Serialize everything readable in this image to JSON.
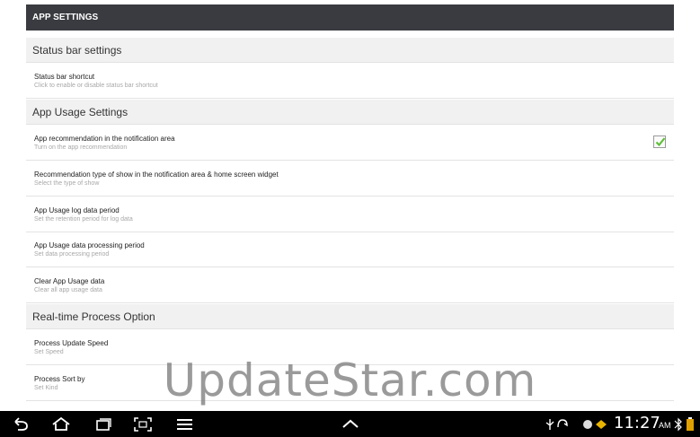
{
  "header": {
    "title": "APP SETTINGS"
  },
  "sections": [
    {
      "title": "Status bar settings"
    },
    {
      "title": "App Usage Settings"
    },
    {
      "title": "Real-time Process Option"
    }
  ],
  "items": [
    {
      "title": "Status bar shortcut",
      "subtitle": "Click to enable or disable status bar shortcut"
    },
    {
      "title": "App recommendation in the notification area",
      "subtitle": "Turn on the app recommendation",
      "checked": true
    },
    {
      "title": "Recommendation type of show in the notification area & home screen widget",
      "subtitle": "Select the type of show"
    },
    {
      "title": "App Usage log data period",
      "subtitle": "Set the retention period for log data"
    },
    {
      "title": "App Usage data processing period",
      "subtitle": "Set data processing period"
    },
    {
      "title": "Clear App Usage data",
      "subtitle": "Clear all app usage data"
    },
    {
      "title": "Process Update Speed",
      "subtitle": "Set Speed"
    },
    {
      "title": "Process Sort by",
      "subtitle": "Set Kind"
    }
  ],
  "watermark": "UpdateStar.com",
  "statusbar": {
    "time": "11:27",
    "ampm": "AM"
  },
  "colors": {
    "titlebar": "#3a3b40",
    "section": "#f1f1f1",
    "check": "#5fbf3a",
    "navbar": "#000000"
  }
}
